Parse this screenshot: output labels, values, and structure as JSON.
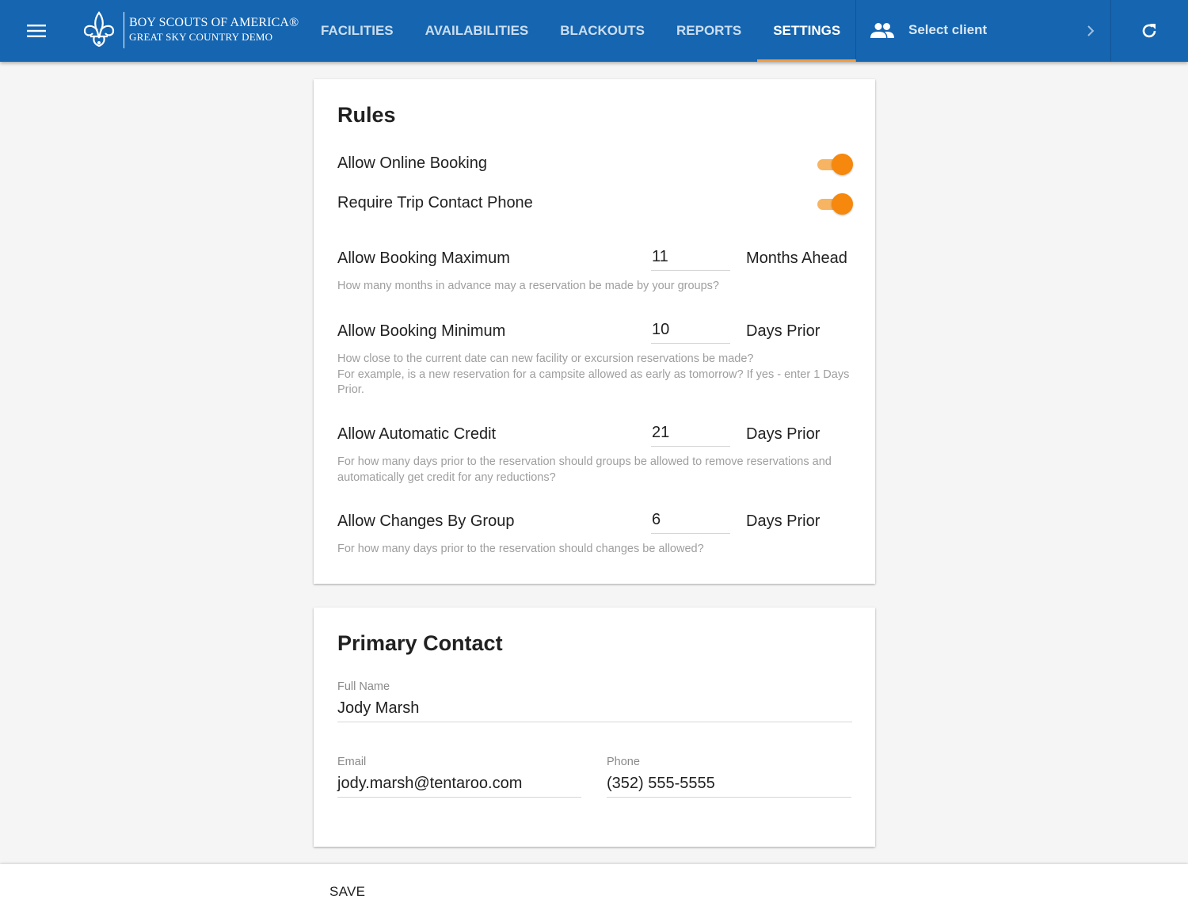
{
  "header": {
    "logo_line1": "BOY SCOUTS OF AMERICA®",
    "logo_line2": "GREAT SKY COUNTRY DEMO",
    "nav": [
      {
        "label": "FACILITIES",
        "active": false
      },
      {
        "label": "AVAILABILITIES",
        "active": false
      },
      {
        "label": "BLACKOUTS",
        "active": false
      },
      {
        "label": "REPORTS",
        "active": false
      },
      {
        "label": "SETTINGS",
        "active": true
      }
    ],
    "client_label": "Select client",
    "icons": {
      "menu": "menu-icon",
      "logo": "fleur-de-lis-icon",
      "client": "people-icon",
      "chevron": "chevron-right-icon",
      "refresh": "refresh-icon"
    }
  },
  "rules": {
    "title": "Rules",
    "toggles": [
      {
        "label": "Allow Online Booking",
        "on": true
      },
      {
        "label": "Require Trip Contact Phone",
        "on": true
      }
    ],
    "items": [
      {
        "label": "Allow Booking Maximum",
        "value": "11",
        "unit": "Months Ahead",
        "help": [
          "How many months in advance may a reservation be made by your groups?"
        ]
      },
      {
        "label": "Allow Booking Minimum",
        "value": "10",
        "unit": "Days Prior",
        "help": [
          "How close to the current date can new facility or excursion reservations be made?",
          "For example, is a new reservation for a campsite allowed as early as tomorrow? If yes - enter 1 Days Prior."
        ]
      },
      {
        "label": "Allow Automatic Credit",
        "value": "21",
        "unit": "Days Prior",
        "help": [
          "For how many days prior to the reservation should groups be allowed to remove reservations and automatically get credit for any reductions?"
        ]
      },
      {
        "label": "Allow Changes By Group",
        "value": "6",
        "unit": "Days Prior",
        "help": [
          "For how many days prior to the reservation should changes be allowed?"
        ]
      }
    ]
  },
  "contact": {
    "title": "Primary Contact",
    "full_name": {
      "label": "Full Name",
      "value": "Jody Marsh"
    },
    "email": {
      "label": "Email",
      "value": "jody.marsh@tentaroo.com"
    },
    "phone": {
      "label": "Phone",
      "value": "(352) 555-5555"
    }
  },
  "footer": {
    "save_label": "SAVE"
  },
  "colors": {
    "appbar": "#1565b0",
    "accent": "#f5880d",
    "accent_track": "#f7b463",
    "tab_indicator": "#f39c3c"
  }
}
